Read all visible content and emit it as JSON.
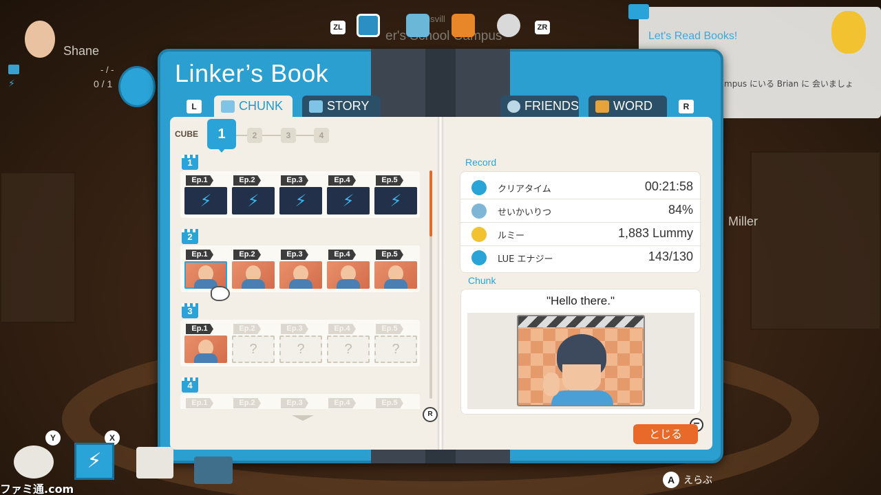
{
  "background": {
    "player_name": "Shane",
    "progress_1": "- / -",
    "progress_2": "0 / 1",
    "npc_name": "Miller",
    "map_label_top": "Ponsvill",
    "map_label_main": "er's School Campus",
    "notification": {
      "title": "Let's Read Books!",
      "message": "mpus にいる Brian に 会いましょ"
    }
  },
  "top_bar": {
    "left_button": "ZL",
    "right_button": "ZR",
    "icons": [
      "linker-book-icon",
      "map-icon",
      "bag-icon",
      "settings-icon"
    ]
  },
  "book": {
    "title": "Linker’s Book",
    "left_key": "L",
    "right_key": "R",
    "tabs": [
      {
        "label": "CHUNK",
        "icon": "chunk-icon",
        "active": true
      },
      {
        "label": "STORY",
        "icon": "story-icon",
        "active": false
      },
      {
        "label": "FRIENDS",
        "icon": "friends-icon",
        "active": false
      },
      {
        "label": "WORD",
        "icon": "word-icon",
        "active": false
      }
    ],
    "cube_label": "CUBE",
    "cube_steps": [
      "1",
      "2",
      "3",
      "4"
    ],
    "selected_cube": "1",
    "chunks": [
      {
        "number": "1",
        "episodes": [
          {
            "label": "Ep.1",
            "state": "energy"
          },
          {
            "label": "Ep.2",
            "state": "energy"
          },
          {
            "label": "Ep.3",
            "state": "energy"
          },
          {
            "label": "Ep.4",
            "state": "energy"
          },
          {
            "label": "Ep.5",
            "state": "energy"
          }
        ]
      },
      {
        "number": "2",
        "episodes": [
          {
            "label": "Ep.1",
            "state": "image",
            "selected": true
          },
          {
            "label": "Ep.2",
            "state": "image"
          },
          {
            "label": "Ep.3",
            "state": "image"
          },
          {
            "label": "Ep.4",
            "state": "image"
          },
          {
            "label": "Ep.5",
            "state": "image"
          }
        ]
      },
      {
        "number": "3",
        "episodes": [
          {
            "label": "Ep.1",
            "state": "image"
          },
          {
            "label": "Ep.2",
            "state": "locked"
          },
          {
            "label": "Ep.3",
            "state": "locked"
          },
          {
            "label": "Ep.4",
            "state": "locked"
          },
          {
            "label": "Ep.5",
            "state": "locked"
          }
        ]
      },
      {
        "number": "4",
        "episodes": [
          {
            "label": "Ep.1",
            "state": "locked"
          },
          {
            "label": "Ep.2",
            "state": "locked"
          },
          {
            "label": "Ep.3",
            "state": "locked"
          },
          {
            "label": "Ep.4",
            "state": "locked"
          },
          {
            "label": "Ep.5",
            "state": "locked"
          }
        ]
      }
    ],
    "locked_mark": "?",
    "scroll_key": "R",
    "record": {
      "heading": "Record",
      "rows": [
        {
          "icon": "stopwatch-icon",
          "label": "クリアタイム",
          "value": "00:21:58",
          "color": "#2aa4d8"
        },
        {
          "icon": "microphone-icon",
          "label": "せいかいりつ",
          "value": "84%",
          "color": "#7fb6d6"
        },
        {
          "icon": "lummy-coin-icon",
          "label": "ルミー",
          "value": "1,883 Lummy",
          "color": "#f2c230"
        },
        {
          "icon": "lightning-icon",
          "label": "LUE エナジー",
          "value": "143/130",
          "color": "#2aa4d8"
        }
      ]
    },
    "chunk_detail": {
      "heading": "Chunk",
      "quote": "\"Hello there.\"",
      "image_icon": "waving-boy-image"
    },
    "close_label": "とじる",
    "close_key": "−"
  },
  "controls": {
    "a_button": "A",
    "a_label": "えらぶ",
    "y_button": "Y",
    "x_button": "X"
  },
  "watermark": "ファミ通.com",
  "colors": {
    "accent_blue": "#2aa4d8",
    "close_orange": "#e8692a",
    "page_bg": "#f3efe6"
  }
}
